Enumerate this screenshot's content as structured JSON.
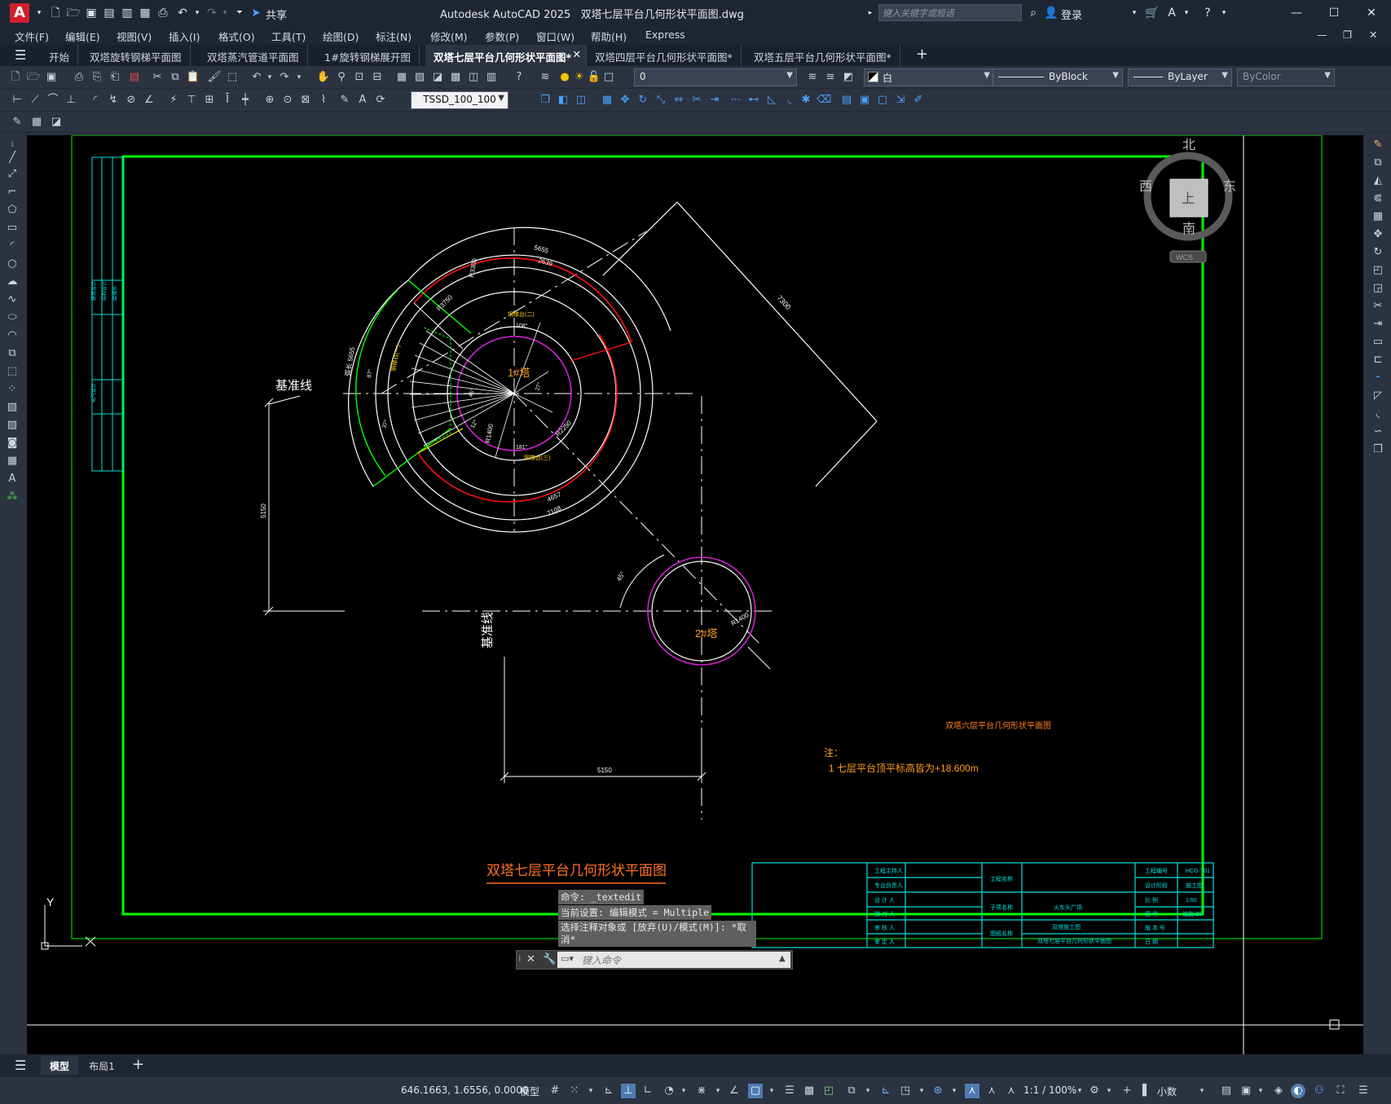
{
  "app": {
    "title": "Autodesk AutoCAD 2025",
    "document": "双塔七层平台几何形状平面图.dwg",
    "search_placeholder": "键入关键字或短语",
    "share": "共享",
    "login": "登录",
    "logo_letter": "A"
  },
  "menus": [
    "文件(F)",
    "编辑(E)",
    "视图(V)",
    "插入(I)",
    "格式(O)",
    "工具(T)",
    "绘图(D)",
    "标注(N)",
    "修改(M)",
    "参数(P)",
    "窗口(W)",
    "帮助(H)",
    "Express"
  ],
  "tabs": [
    {
      "label": "开始"
    },
    {
      "label": "双塔旋转钢梯平面图"
    },
    {
      "label": "双塔蒸汽管道平面图"
    },
    {
      "label": "1#旋转钢梯展开图"
    },
    {
      "label": "双塔七层平台几何形状平面图*",
      "active": true
    },
    {
      "label": "双塔四层平台几何形状平面图*"
    },
    {
      "label": "双塔五层平台几何形状平面图*"
    }
  ],
  "props": {
    "layer": "0",
    "color": "白",
    "linetype": "ByBlock",
    "lineweight": "ByLayer",
    "plotstyle": "ByColor",
    "textstyle": "TSSD_100_100"
  },
  "viewcube": {
    "north": "北",
    "south": "南",
    "east": "东",
    "west": "西",
    "top": "上",
    "wcs": "WCS"
  },
  "drawing": {
    "title": "双塔七层平台几何形状平面图",
    "baseline_h": "基准线",
    "baseline_v": "基准线",
    "tower1": "1#塔",
    "tower2": "2#塔",
    "dim_left": "5150",
    "dim_bottom": "5150",
    "dim_diag": "7300",
    "r_2": "R1400",
    "r_1": "R1400",
    "r_3750": "R3750",
    "r_3300": "R3300",
    "r_2250": "R2250",
    "arc_5655": "5655",
    "arc_2639": "2639",
    "arc_7108": "7108",
    "arc_4657": "4657",
    "ang_108": "108°",
    "ang_181": "181°",
    "ang_45": "45°",
    "ang_27": "27°",
    "ang_87": "87°",
    "ang_37": "37°",
    "ang_12": "12°",
    "stair_label1": "钢梯台(二)",
    "stair_label2": "钢梯台(三)",
    "stair_label3": "钢梯台(一)",
    "side_small": "栏杆外缘",
    "ring_text": "弧长 5655",
    "other_title": "双塔六层平台几何形状平面图",
    "note_head": "注：",
    "note_1": "1 七层平台顶平标高皆为+18.600m"
  },
  "titleblock": {
    "c1": [
      "工程主持人",
      "专业负责人",
      "设 计 人",
      "校 对 人",
      "审 核 人",
      "审 定 人"
    ],
    "c2": [
      "工程名称",
      "",
      "子项名称",
      "",
      "图纸名称",
      ""
    ],
    "proj": "火车头广场",
    "sub": "双塔施工图",
    "name": "双塔七层平台几何形状平面图",
    "c3": [
      "工程编号",
      "设计阶段",
      "比   例",
      "图   号",
      "版 本 号",
      "日   期"
    ],
    "c4": [
      "HCG-T01",
      "施工图",
      "1:50",
      "结施-26",
      "",
      ""
    ]
  },
  "sidestrip": {
    "t1": "建筑设计",
    "t2": "结构设计",
    "t3": "给排水",
    "t4": "电气设计"
  },
  "command": {
    "l1": "命令: _textedit",
    "l2": "当前设置: 编辑模式 = Multiple",
    "l3": "选择注释对象或 [放弃(U)/模式(M)]: *取消*",
    "placeholder": "键入命令"
  },
  "ucs": {
    "y": "Y",
    "x": "X"
  },
  "layouts": [
    "模型",
    "布局1"
  ],
  "status": {
    "coords": "646.1663, 1.6556, 0.0000",
    "space": "模型",
    "scale": "1:1 / 100%",
    "units": "小数"
  }
}
